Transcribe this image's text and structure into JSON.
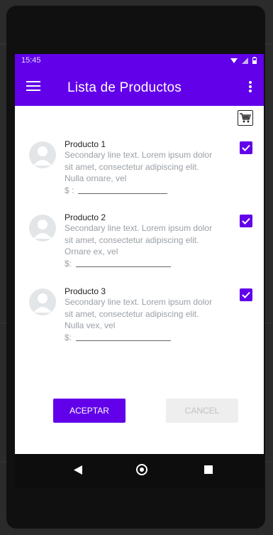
{
  "status_bar": {
    "time": "15:45"
  },
  "app_bar": {
    "title": "Lista de  Productos"
  },
  "products": [
    {
      "title": "Producto 1",
      "description": "Secondary line text. Lorem ipsum dolor sit amet, consectetur adipiscing elit. Nulla ornare, vel",
      "price_label": "$ :",
      "checked": true
    },
    {
      "title": "Producto 2",
      "description": "Secondary line text. Lorem ipsum dolor sit amet, consectetur adipiscing elit. Ornare ex, vel",
      "price_label": "$:",
      "checked": true
    },
    {
      "title": "Producto 3",
      "description": "Secondary line text. Lorem ipsum dolor sit amet, consectetur adipiscing elit. Nulla vex, vel",
      "price_label": "$:",
      "checked": true
    }
  ],
  "buttons": {
    "accept": "ACEPTAR",
    "cancel": "CANCEL"
  },
  "colors": {
    "primary": "#6200ea",
    "avatar": "#e3e6e8",
    "secondary_text": "#9aa0a6"
  },
  "icons": [
    "menu-icon",
    "overflow-menu-icon",
    "shopping-cart-icon",
    "wifi-icon",
    "signal-icon",
    "battery-icon",
    "back-icon",
    "home-icon",
    "recent-apps-icon"
  ]
}
